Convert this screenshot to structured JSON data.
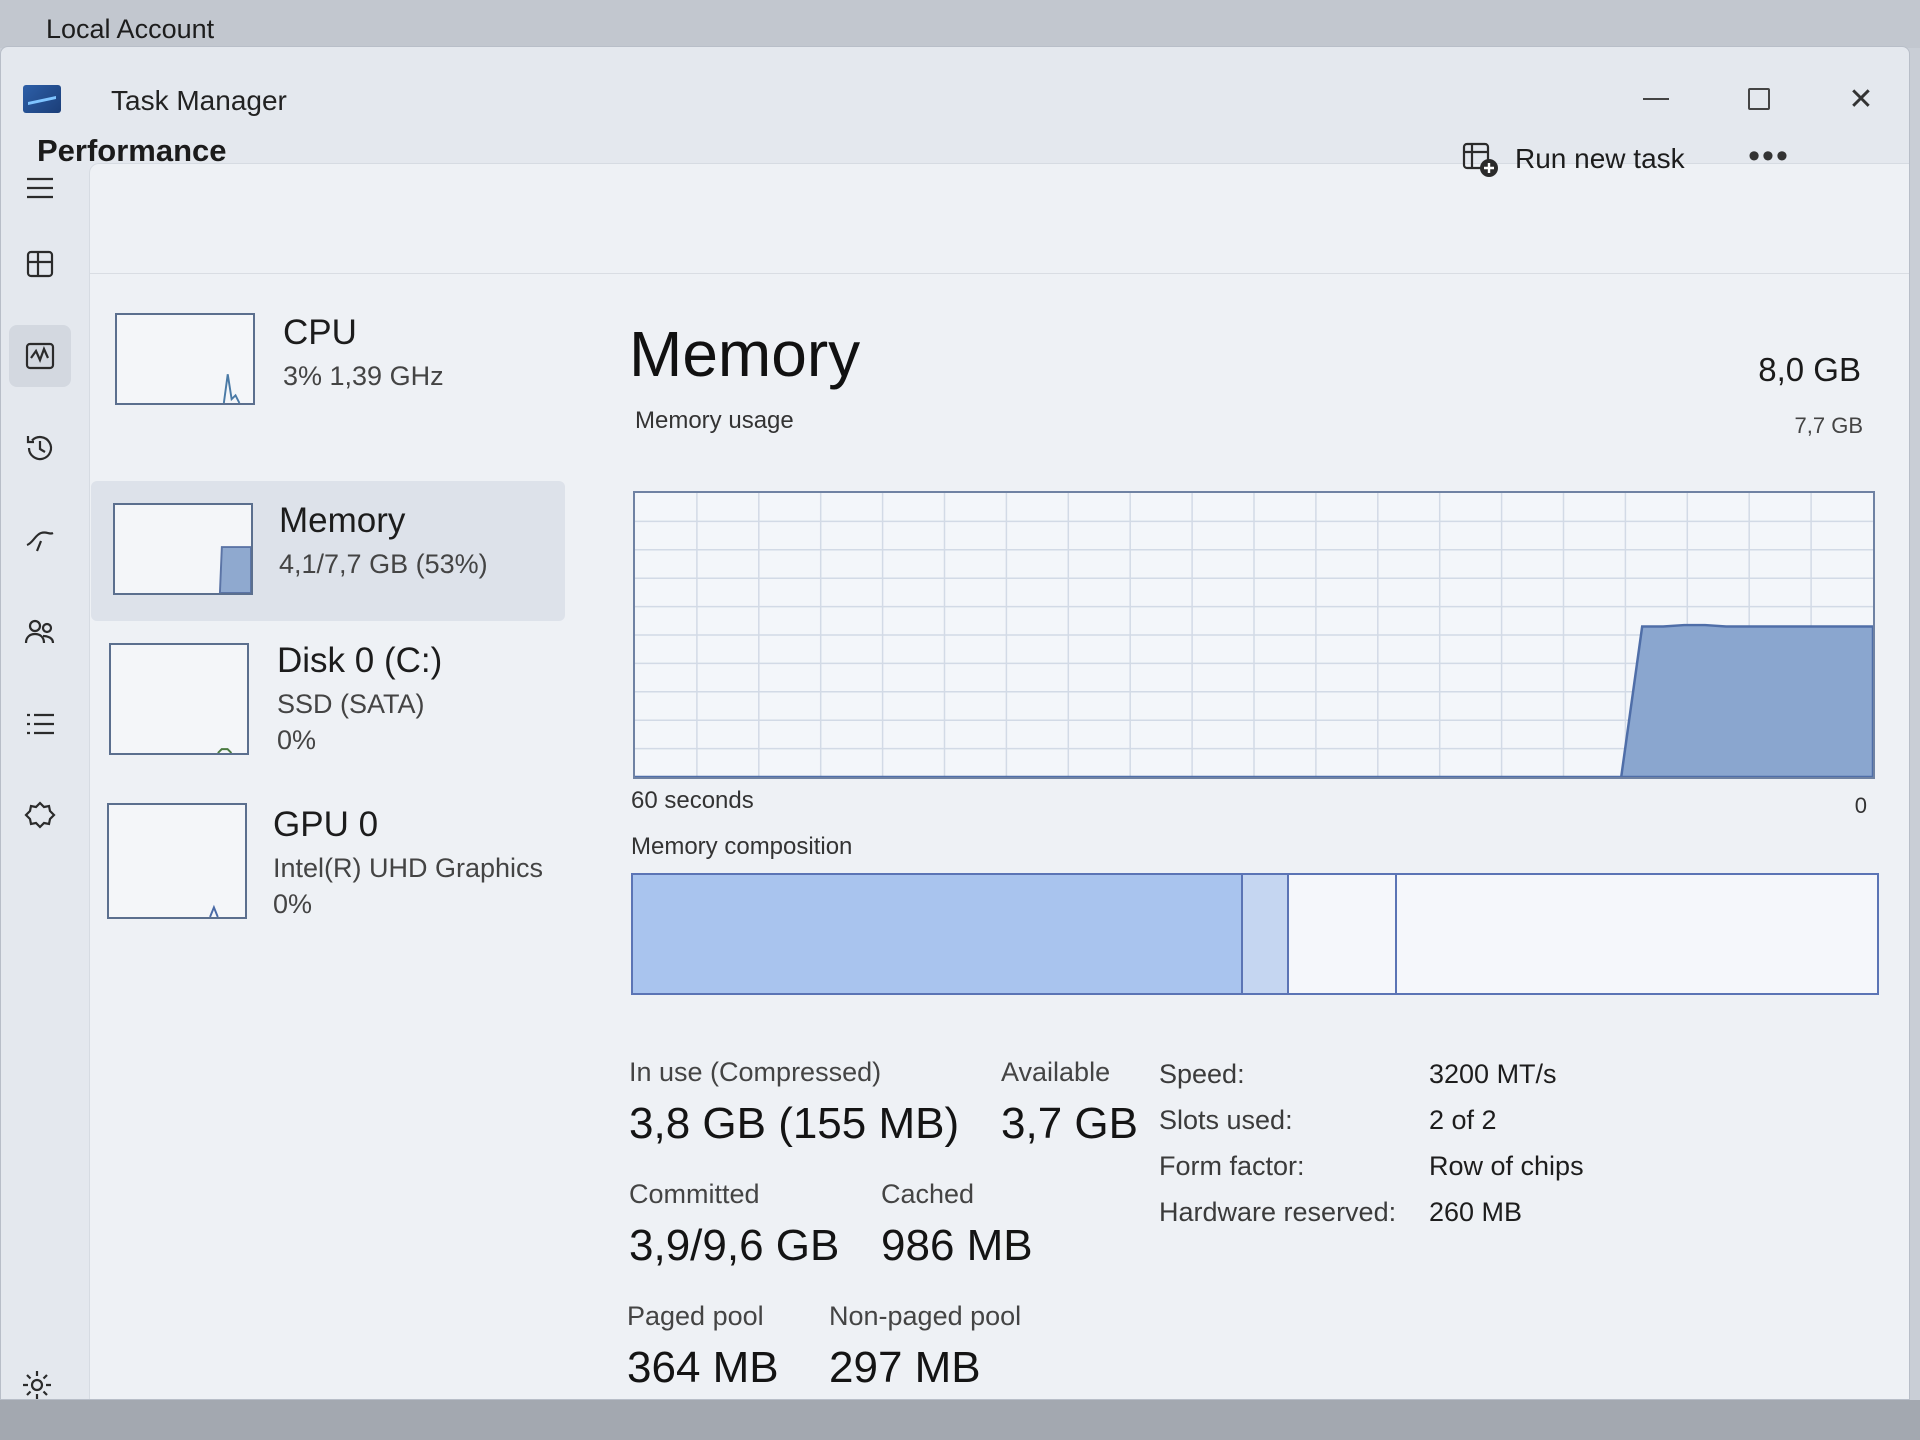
{
  "background": {
    "account_label": "Local Account"
  },
  "window": {
    "title": "Task Manager",
    "controls": {
      "minimize": "minimize",
      "maximize": "maximize",
      "close": "✕"
    }
  },
  "header": {
    "title": "Performance",
    "run_new_task": "Run new task",
    "more": "•••"
  },
  "rail": {
    "items": [
      "hamburger-icon",
      "processes-icon",
      "performance-icon",
      "history-icon",
      "startup-icon",
      "users-icon",
      "details-icon",
      "services-icon"
    ],
    "settings": "settings-icon"
  },
  "devices": [
    {
      "name": "CPU",
      "sub1": "3%  1,39 GHz",
      "sub2": ""
    },
    {
      "name": "Memory",
      "sub1": "4,1/7,7 GB (53%)",
      "sub2": ""
    },
    {
      "name": "Disk 0 (C:)",
      "sub1": "SSD (SATA)",
      "sub2": "0%"
    },
    {
      "name": "GPU 0",
      "sub1": "Intel(R) UHD Graphics",
      "sub2": "0%"
    }
  ],
  "detail": {
    "title": "Memory",
    "total": "8,0 GB",
    "usage_label": "Memory usage",
    "usage_max": "7,7 GB",
    "time_label": "60 seconds",
    "zero_label": "0",
    "composition_label": "Memory composition",
    "usage_history_fraction": [
      0,
      0,
      0,
      0,
      0,
      0,
      0,
      0,
      0,
      0,
      0,
      0,
      0,
      0,
      0,
      0,
      0,
      0,
      0,
      0,
      0,
      0,
      0,
      0,
      0,
      0,
      0,
      0,
      0,
      0,
      0,
      0,
      0,
      0,
      0,
      0,
      0,
      0,
      0,
      0,
      0,
      0,
      0,
      0,
      0,
      0,
      0,
      0,
      0.53,
      0.53,
      0.535,
      0.535,
      0.53,
      0.53,
      0.53,
      0.53,
      0.53,
      0.53,
      0.53,
      0.53
    ],
    "composition_fractions": {
      "in_use": 0.49,
      "modified": 0.037,
      "standby": 0.087
    },
    "stats": {
      "in_use_label": "In use (Compressed)",
      "in_use_value": "3,8 GB (155 MB)",
      "available_label": "Available",
      "available_value": "3,7 GB",
      "committed_label": "Committed",
      "committed_value": "3,9/9,6 GB",
      "cached_label": "Cached",
      "cached_value": "986 MB",
      "paged_label": "Paged pool",
      "paged_value": "364 MB",
      "nonpaged_label": "Non-paged pool",
      "nonpaged_value": "297 MB"
    },
    "specs": [
      {
        "label": "Speed:",
        "value": "3200 MT/s"
      },
      {
        "label": "Slots used:",
        "value": "2 of 2"
      },
      {
        "label": "Form factor:",
        "value": "Row of chips"
      },
      {
        "label": "Hardware reserved:",
        "value": "260 MB"
      }
    ]
  }
}
